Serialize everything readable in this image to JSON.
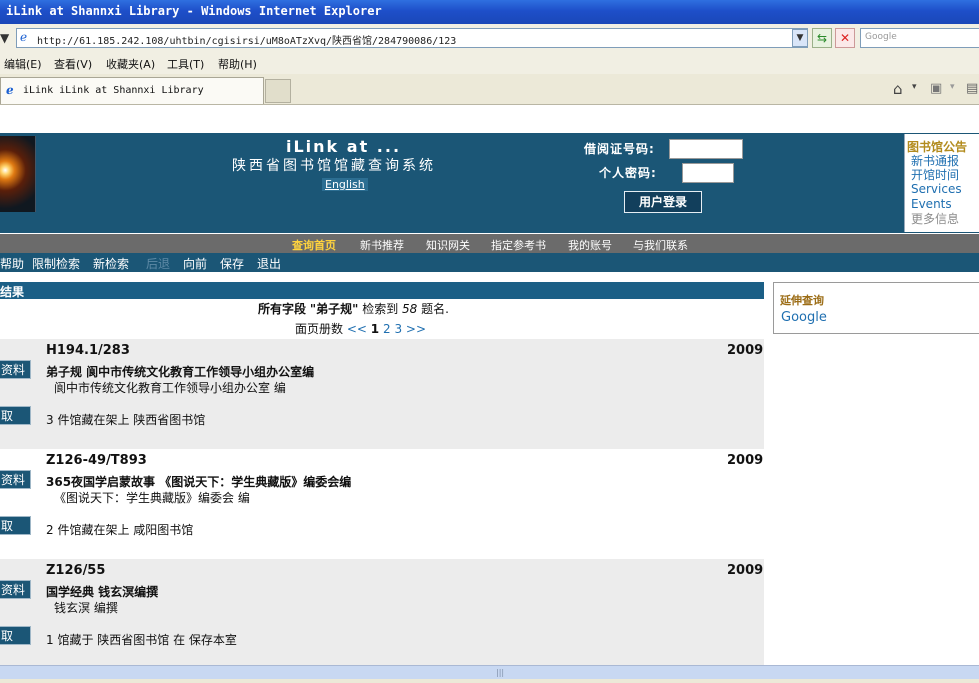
{
  "window": {
    "title": "iLink at Shannxi Library - Windows Internet Explorer"
  },
  "address_bar": {
    "url": "http://61.185.242.108/uhtbin/cgisirsi/uM8oATzXvq/陕西省馆/284790086/123",
    "search_placeholder": "Google"
  },
  "menu": {
    "items": [
      "编辑(E)",
      "查看(V)",
      "收藏夹(A)",
      "工具(T)",
      "帮助(H)"
    ]
  },
  "tab": {
    "label": "iLink iLink at Shannxi Library"
  },
  "header": {
    "title": "iLink at ...",
    "subtitle": "陕西省图书馆馆藏查询系统",
    "english_link": "English",
    "card_label": "借阅证号码:",
    "password_label": "个人密码:",
    "login_button": "用户登录"
  },
  "notice": {
    "title": "图书馆公告",
    "items": [
      "新书通报",
      "开馆时间",
      "Services",
      "Events",
      "更多信息"
    ]
  },
  "nav": {
    "items": [
      "查询首页",
      "新书推荐",
      "知识网关",
      "指定参考书",
      "我的账号",
      "与我们联系"
    ]
  },
  "toolbar": {
    "items": [
      "帮助",
      "限制检索",
      "新检索",
      "后退",
      "向前",
      "保存",
      "退出"
    ]
  },
  "results": {
    "header": "结果",
    "summary_field": "所有字段",
    "summary_term": "\"弟子规\"",
    "summary_mid": "检索到",
    "summary_count": "58",
    "summary_unit": "题名.",
    "paging_label": "面页册数",
    "paging_prev": "<<",
    "paging_current": "1",
    "paging_pages": [
      "2",
      "3"
    ],
    "paging_next": ">>",
    "details_button": "资料",
    "request_button": "取",
    "records": [
      {
        "call_number": "H194.1/283",
        "year": "2009",
        "title": "弟子规 阆中市传统文化教育工作领导小组办公室编",
        "author": "阆中市传统文化教育工作领导小组办公室 编",
        "holdings": "3 件馆藏在架上 陕西省图书馆"
      },
      {
        "call_number": "Z126-49/T893",
        "year": "2009",
        "title": "365夜国学启蒙故事 《图说天下：学生典藏版》编委会编",
        "author": "《图说天下：学生典藏版》编委会 编",
        "holdings": "2 件馆藏在架上 咸阳图书馆"
      },
      {
        "call_number": "Z126/55",
        "year": "2009",
        "title": "国学经典 钱玄溟编撰",
        "author": "钱玄溟 编撰",
        "holdings": "1 馆藏于 陕西省图书馆 在 保存本室"
      }
    ]
  },
  "sidebar": {
    "title": "延伸查询",
    "google_link": "Google"
  }
}
